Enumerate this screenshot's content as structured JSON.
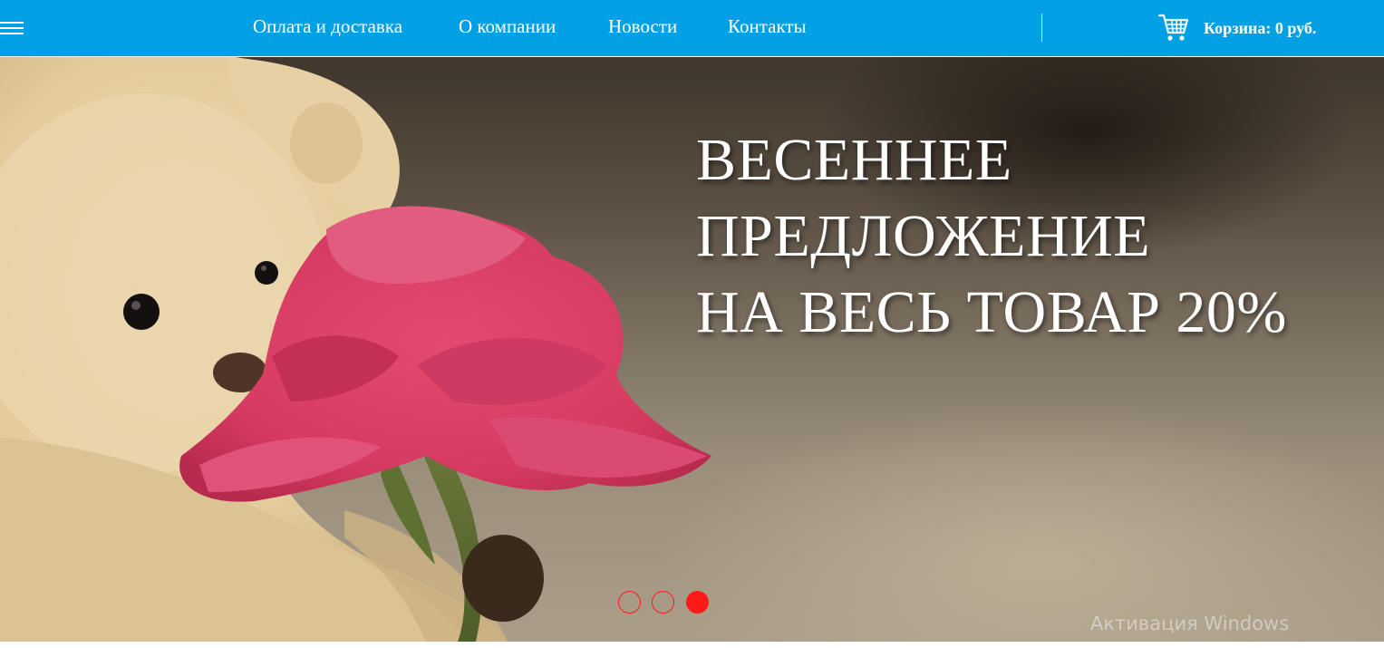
{
  "nav": {
    "menu_icon": "hamburger-menu-icon",
    "items": [
      {
        "label": "Оплата и доставка"
      },
      {
        "label": "О компании"
      },
      {
        "label": "Новости"
      },
      {
        "label": "Контакты"
      }
    ]
  },
  "cart": {
    "icon": "shopping-cart-icon",
    "label": "Корзина: 0 руб."
  },
  "hero": {
    "headline_lines": [
      "ВЕСЕННЕЕ",
      "ПРЕДЛОЖЕНИЕ",
      "НА ВЕСЬ ТОВАР 20%"
    ],
    "image": "teddy-bear-holding-pink-rose",
    "slides_total": 3,
    "active_slide": 3
  },
  "system": {
    "watermark": "Активация Windows"
  },
  "colors": {
    "header_bg": "#00a1e4",
    "slider_dot": "#ff1a1a",
    "headline_text": "#ffffff"
  }
}
